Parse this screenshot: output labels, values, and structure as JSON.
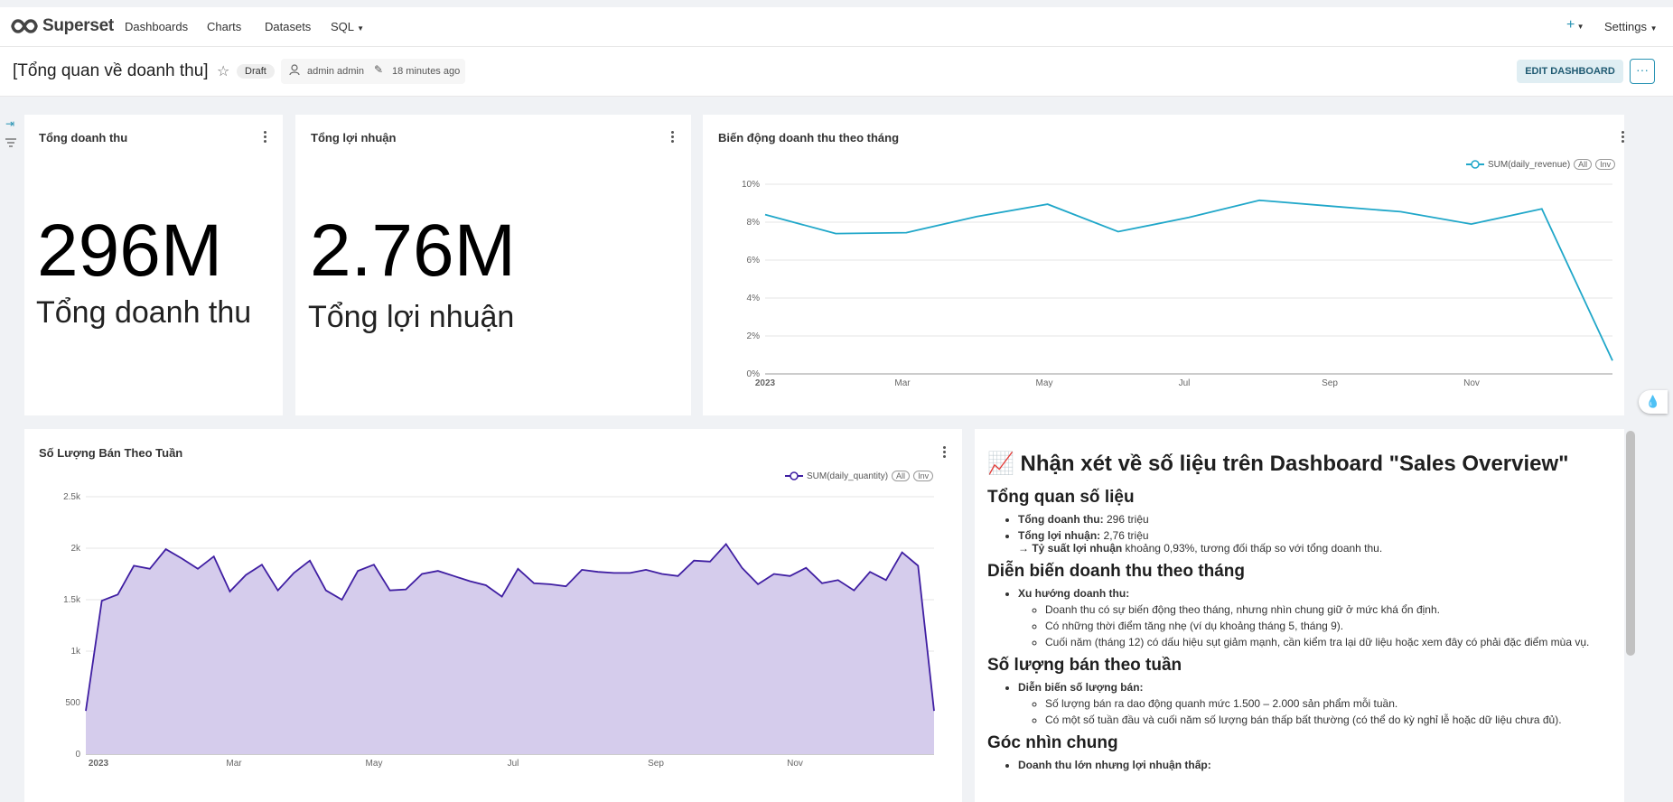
{
  "nav": {
    "brand": "Superset",
    "items": [
      "Dashboards",
      "Charts",
      "Datasets",
      "SQL"
    ],
    "plus": "+",
    "settings": "Settings"
  },
  "header": {
    "title": "[Tổng quan về doanh thu]",
    "status": "Draft",
    "owner": "admin admin",
    "modified": "18 minutes ago",
    "edit_button": "EDIT DASHBOARD",
    "more_button": "···"
  },
  "cards": {
    "revenue": {
      "title": "Tổng doanh thu",
      "value": "296M",
      "subtitle": "Tổng doanh thu"
    },
    "profit": {
      "title": "Tổng lợi nhuận",
      "value": "2.76M",
      "subtitle": "Tổng lợi nhuận"
    }
  },
  "legend_controls": {
    "all": "All",
    "inv": "Inv"
  },
  "chart_data": [
    {
      "type": "line",
      "title": "Biến động doanh thu theo tháng",
      "series": [
        {
          "name": "SUM(daily_revenue)",
          "values": [
            8.4,
            7.4,
            7.45,
            8.3,
            8.95,
            7.5,
            8.25,
            9.15,
            8.85,
            8.55,
            7.9,
            8.7,
            0.7
          ],
          "color": "#20a7c9"
        }
      ],
      "x": [
        "2023-01",
        "2023-02",
        "2023-03",
        "2023-04",
        "2023-05",
        "2023-06",
        "2023-07",
        "2023-08",
        "2023-09",
        "2023-10",
        "2023-11",
        "2023-12",
        "2024-01"
      ],
      "xticks": [
        "2023",
        "Mar",
        "May",
        "Jul",
        "Sep",
        "Nov"
      ],
      "yticks": [
        "0%",
        "2%",
        "4%",
        "6%",
        "8%",
        "10%"
      ],
      "ylim": [
        0,
        10
      ],
      "grid": true,
      "legend": "top-right"
    },
    {
      "type": "area",
      "title": "Số Lượng Bán Theo Tuần",
      "series": [
        {
          "name": "SUM(daily_quantity)",
          "values": [
            420,
            1490,
            1550,
            1830,
            1800,
            1990,
            1900,
            1800,
            1920,
            1580,
            1740,
            1840,
            1590,
            1760,
            1880,
            1590,
            1500,
            1780,
            1840,
            1590,
            1600,
            1750,
            1780,
            1730,
            1680,
            1640,
            1530,
            1800,
            1660,
            1650,
            1630,
            1790,
            1770,
            1760,
            1760,
            1790,
            1750,
            1730,
            1880,
            1870,
            2040,
            1810,
            1650,
            1750,
            1730,
            1810,
            1660,
            1690,
            1590,
            1770,
            1690,
            1960,
            1830,
            420
          ],
          "color": "#3f1ea2",
          "fill": "#d5ccec"
        }
      ],
      "xticks": [
        "2023",
        "Mar",
        "May",
        "Jul",
        "Sep",
        "Nov"
      ],
      "yticks": [
        "0",
        "500",
        "1k",
        "1.5k",
        "2k",
        "2.5k"
      ],
      "ylim": [
        0,
        2500
      ],
      "grid": true,
      "legend": "top-right"
    }
  ],
  "text_panel": {
    "heading": "📈 Nhận xét về số liệu trên Dashboard \"Sales Overview\"",
    "s1": {
      "title": "Tổng quan số liệu",
      "b1_label": "Tổng doanh thu:",
      "b1_text": " 296 triệu",
      "b2_label": "Tổng lợi nhuận:",
      "b2_text": " 2,76 triệu",
      "b3_arrow": "→ ",
      "b3_label": "Tỷ suất lợi nhuận",
      "b3_text": " khoảng 0,93%, tương đối thấp so với tổng doanh thu."
    },
    "s2": {
      "title": "Diễn biến doanh thu theo tháng",
      "b1_label": "Xu hướng doanh thu:",
      "sub": [
        "Doanh thu có sự biến động theo tháng, nhưng nhìn chung giữ ở mức khá ổn định.",
        "Có những thời điểm tăng nhẹ (ví dụ khoảng tháng 5, tháng 9).",
        "Cuối năm (tháng 12) có dấu hiệu sụt giảm mạnh, cần kiểm tra lại dữ liệu hoặc xem đây có phải đặc điểm mùa vụ."
      ]
    },
    "s3": {
      "title": "Số lượng bán theo tuần",
      "b1_label": "Diễn biến số lượng bán:",
      "sub": [
        "Số lượng bán ra dao động quanh mức 1.500 – 2.000 sản phẩm mỗi tuần.",
        "Có một số tuần đầu và cuối năm số lượng bán thấp bất thường (có thể do kỳ nghỉ lễ hoặc dữ liệu chưa đủ)."
      ]
    },
    "s4": {
      "title": "Góc nhìn chung",
      "b1_label": "Doanh thu lớn nhưng lợi nhuận thấp:"
    }
  }
}
